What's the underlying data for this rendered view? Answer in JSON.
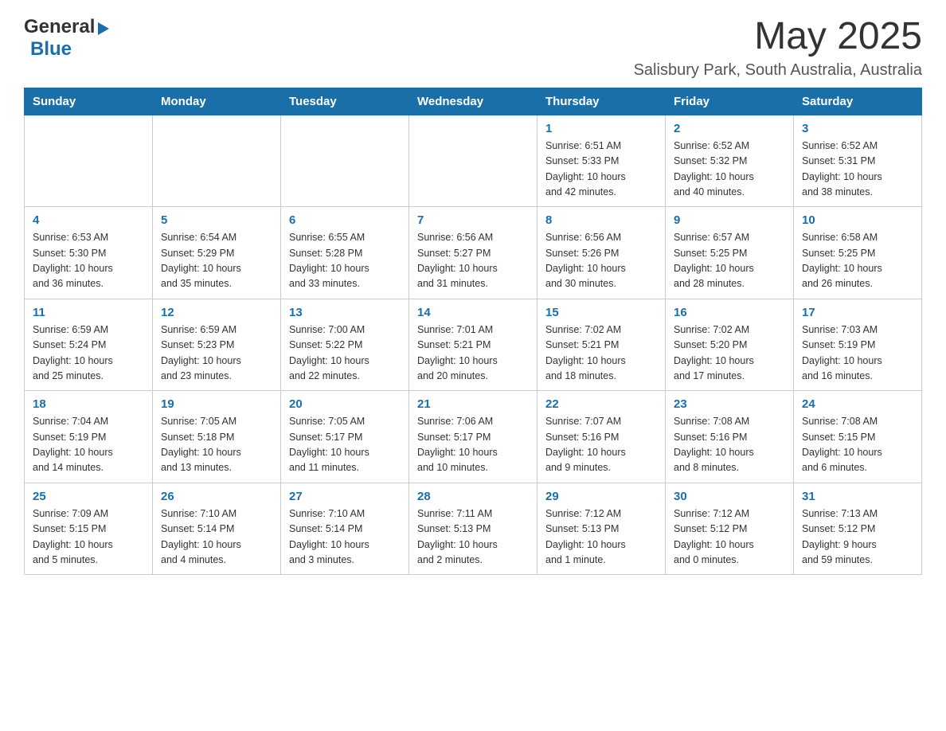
{
  "header": {
    "logo_general": "General",
    "logo_blue": "Blue",
    "month_title": "May 2025",
    "location": "Salisbury Park, South Australia, Australia"
  },
  "days_of_week": [
    "Sunday",
    "Monday",
    "Tuesday",
    "Wednesday",
    "Thursday",
    "Friday",
    "Saturday"
  ],
  "weeks": [
    [
      {
        "day": "",
        "info": ""
      },
      {
        "day": "",
        "info": ""
      },
      {
        "day": "",
        "info": ""
      },
      {
        "day": "",
        "info": ""
      },
      {
        "day": "1",
        "info": "Sunrise: 6:51 AM\nSunset: 5:33 PM\nDaylight: 10 hours\nand 42 minutes."
      },
      {
        "day": "2",
        "info": "Sunrise: 6:52 AM\nSunset: 5:32 PM\nDaylight: 10 hours\nand 40 minutes."
      },
      {
        "day": "3",
        "info": "Sunrise: 6:52 AM\nSunset: 5:31 PM\nDaylight: 10 hours\nand 38 minutes."
      }
    ],
    [
      {
        "day": "4",
        "info": "Sunrise: 6:53 AM\nSunset: 5:30 PM\nDaylight: 10 hours\nand 36 minutes."
      },
      {
        "day": "5",
        "info": "Sunrise: 6:54 AM\nSunset: 5:29 PM\nDaylight: 10 hours\nand 35 minutes."
      },
      {
        "day": "6",
        "info": "Sunrise: 6:55 AM\nSunset: 5:28 PM\nDaylight: 10 hours\nand 33 minutes."
      },
      {
        "day": "7",
        "info": "Sunrise: 6:56 AM\nSunset: 5:27 PM\nDaylight: 10 hours\nand 31 minutes."
      },
      {
        "day": "8",
        "info": "Sunrise: 6:56 AM\nSunset: 5:26 PM\nDaylight: 10 hours\nand 30 minutes."
      },
      {
        "day": "9",
        "info": "Sunrise: 6:57 AM\nSunset: 5:25 PM\nDaylight: 10 hours\nand 28 minutes."
      },
      {
        "day": "10",
        "info": "Sunrise: 6:58 AM\nSunset: 5:25 PM\nDaylight: 10 hours\nand 26 minutes."
      }
    ],
    [
      {
        "day": "11",
        "info": "Sunrise: 6:59 AM\nSunset: 5:24 PM\nDaylight: 10 hours\nand 25 minutes."
      },
      {
        "day": "12",
        "info": "Sunrise: 6:59 AM\nSunset: 5:23 PM\nDaylight: 10 hours\nand 23 minutes."
      },
      {
        "day": "13",
        "info": "Sunrise: 7:00 AM\nSunset: 5:22 PM\nDaylight: 10 hours\nand 22 minutes."
      },
      {
        "day": "14",
        "info": "Sunrise: 7:01 AM\nSunset: 5:21 PM\nDaylight: 10 hours\nand 20 minutes."
      },
      {
        "day": "15",
        "info": "Sunrise: 7:02 AM\nSunset: 5:21 PM\nDaylight: 10 hours\nand 18 minutes."
      },
      {
        "day": "16",
        "info": "Sunrise: 7:02 AM\nSunset: 5:20 PM\nDaylight: 10 hours\nand 17 minutes."
      },
      {
        "day": "17",
        "info": "Sunrise: 7:03 AM\nSunset: 5:19 PM\nDaylight: 10 hours\nand 16 minutes."
      }
    ],
    [
      {
        "day": "18",
        "info": "Sunrise: 7:04 AM\nSunset: 5:19 PM\nDaylight: 10 hours\nand 14 minutes."
      },
      {
        "day": "19",
        "info": "Sunrise: 7:05 AM\nSunset: 5:18 PM\nDaylight: 10 hours\nand 13 minutes."
      },
      {
        "day": "20",
        "info": "Sunrise: 7:05 AM\nSunset: 5:17 PM\nDaylight: 10 hours\nand 11 minutes."
      },
      {
        "day": "21",
        "info": "Sunrise: 7:06 AM\nSunset: 5:17 PM\nDaylight: 10 hours\nand 10 minutes."
      },
      {
        "day": "22",
        "info": "Sunrise: 7:07 AM\nSunset: 5:16 PM\nDaylight: 10 hours\nand 9 minutes."
      },
      {
        "day": "23",
        "info": "Sunrise: 7:08 AM\nSunset: 5:16 PM\nDaylight: 10 hours\nand 8 minutes."
      },
      {
        "day": "24",
        "info": "Sunrise: 7:08 AM\nSunset: 5:15 PM\nDaylight: 10 hours\nand 6 minutes."
      }
    ],
    [
      {
        "day": "25",
        "info": "Sunrise: 7:09 AM\nSunset: 5:15 PM\nDaylight: 10 hours\nand 5 minutes."
      },
      {
        "day": "26",
        "info": "Sunrise: 7:10 AM\nSunset: 5:14 PM\nDaylight: 10 hours\nand 4 minutes."
      },
      {
        "day": "27",
        "info": "Sunrise: 7:10 AM\nSunset: 5:14 PM\nDaylight: 10 hours\nand 3 minutes."
      },
      {
        "day": "28",
        "info": "Sunrise: 7:11 AM\nSunset: 5:13 PM\nDaylight: 10 hours\nand 2 minutes."
      },
      {
        "day": "29",
        "info": "Sunrise: 7:12 AM\nSunset: 5:13 PM\nDaylight: 10 hours\nand 1 minute."
      },
      {
        "day": "30",
        "info": "Sunrise: 7:12 AM\nSunset: 5:12 PM\nDaylight: 10 hours\nand 0 minutes."
      },
      {
        "day": "31",
        "info": "Sunrise: 7:13 AM\nSunset: 5:12 PM\nDaylight: 9 hours\nand 59 minutes."
      }
    ]
  ]
}
